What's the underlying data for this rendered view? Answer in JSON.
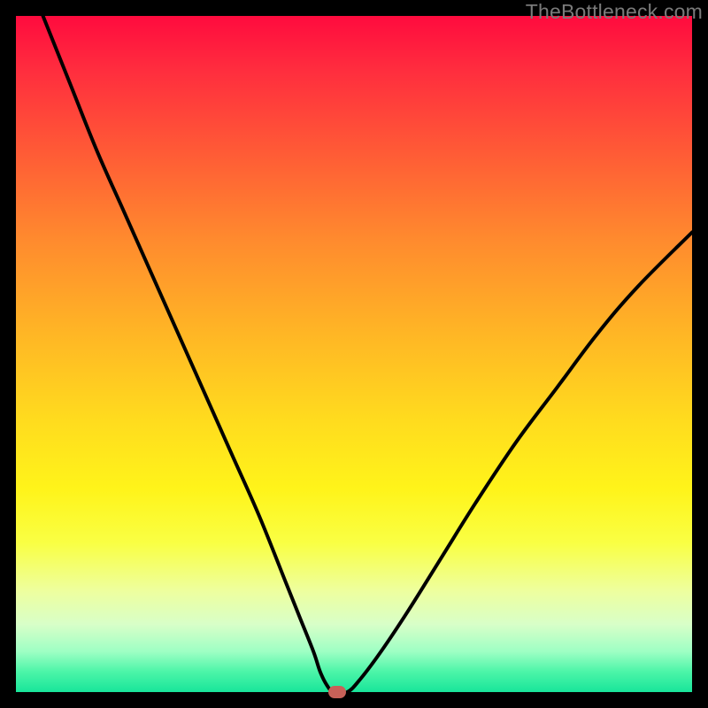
{
  "watermark": "TheBottleneck.com",
  "colors": {
    "frame": "#000000",
    "gradient_top": "#ff0b3e",
    "gradient_bottom": "#18e59a",
    "curve": "#000000",
    "marker": "#c76158"
  },
  "chart_data": {
    "type": "line",
    "title": "",
    "xlabel": "",
    "ylabel": "",
    "xlim": [
      0,
      100
    ],
    "ylim": [
      0,
      100
    ],
    "series": [
      {
        "name": "bottleneck-curve",
        "x": [
          4,
          8,
          12,
          16,
          20,
          24,
          28,
          32,
          36,
          40,
          42,
          44,
          45,
          46,
          47,
          49,
          51,
          54,
          58,
          63,
          68,
          74,
          80,
          86,
          92,
          100
        ],
        "y": [
          100,
          90,
          80,
          71,
          62,
          53,
          44,
          35,
          26,
          16,
          11,
          6,
          3,
          1,
          0,
          0,
          2,
          6,
          12,
          20,
          28,
          37,
          45,
          53,
          60,
          68
        ]
      }
    ],
    "marker": {
      "x": 47.5,
      "y": 0
    },
    "grid": false,
    "legend": false
  }
}
